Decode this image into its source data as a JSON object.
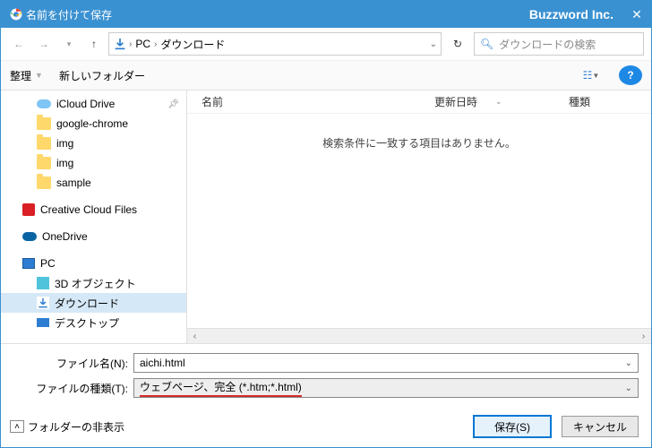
{
  "title": "名前を付けて保存",
  "brand": "Buzzword Inc.",
  "breadcrumb": {
    "a": "PC",
    "b": "ダウンロード"
  },
  "search_placeholder": "ダウンロードの検索",
  "toolbar": {
    "organize": "整理",
    "newfolder": "新しいフォルダー"
  },
  "cols": {
    "name": "名前",
    "modified": "更新日時",
    "type": "種類"
  },
  "empty_msg": "検索条件に一致する項目はありません。",
  "tree": {
    "icloud": "iCloud Drive",
    "gchrome": "google-chrome",
    "img1": "img",
    "img2": "img",
    "sample": "sample",
    "cc": "Creative Cloud Files",
    "onedrive": "OneDrive",
    "pc": "PC",
    "obj3d": "3D オブジェクト",
    "downloads": "ダウンロード",
    "desktop": "デスクトップ"
  },
  "form": {
    "filename_label": "ファイル名(N):",
    "filename_value": "aichi.html",
    "filetype_label": "ファイルの種類(T):",
    "filetype_value": "ウェブページ、完全 (*.htm;*.html)"
  },
  "actions": {
    "hide_folders": "フォルダーの非表示",
    "save": "保存(S)",
    "cancel": "キャンセル"
  }
}
